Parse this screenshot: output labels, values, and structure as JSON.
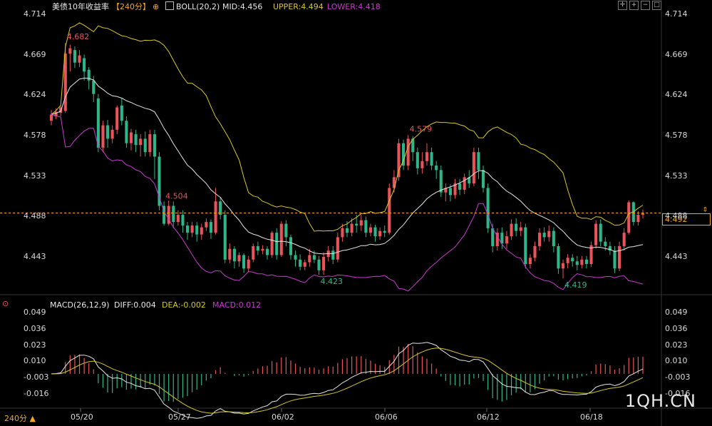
{
  "header": {
    "instrument": "美债10年收益率",
    "period_badge": "【240分】",
    "indicator_name": "BOLL(20,2)",
    "mid": "MID:4.456",
    "upper": "UPPER:4.494",
    "lower": "LOWER:4.418"
  },
  "macd_header": {
    "name": "MACD(26,12,9)",
    "diff": "DIFF:0.004",
    "dea": "DEA:-0.002",
    "macd": "MACD:0.012"
  },
  "price_axis": [
    "4.714",
    "4.669",
    "4.624",
    "4.578",
    "4.533",
    "4.488",
    "4.443"
  ],
  "macd_axis": [
    "0.049",
    "0.036",
    "0.023",
    "0.010",
    "-0.003",
    "-0.016"
  ],
  "date_axis": [
    "05/20",
    "05/27",
    "06/02",
    "06/06",
    "06/12",
    "06/18"
  ],
  "annotations": {
    "high1": "4.682",
    "high2": "4.579",
    "high3": "4.504",
    "low1": "4.423",
    "low2": "4.419"
  },
  "current_price": "4.492",
  "period_selector": "240分",
  "watermark": "1QH.CN",
  "colors": {
    "up": "#e8545a",
    "down": "#2fb58a",
    "mid": "#e6e6e6",
    "upper": "#d8c72b",
    "lower": "#c93ad0",
    "dea": "#d8c72b",
    "price_line": "#f5a623"
  },
  "icons": [
    "settings-gear-icon",
    "crosshair-icon",
    "zoom-in-icon",
    "zoom-out-icon",
    "fullscreen-icon",
    "chart-type-icon"
  ],
  "chart_data": [
    {
      "type": "candlestick",
      "title": "美债10年收益率",
      "period": "240分",
      "ylim": [
        4.4,
        4.72
      ],
      "x_dates": [
        "05/20",
        "05/27",
        "06/02",
        "06/06",
        "06/12",
        "06/18"
      ],
      "candles": [
        [
          4.595,
          4.602,
          4.59,
          4.607
        ],
        [
          4.6,
          4.605,
          4.597,
          4.609
        ],
        [
          4.604,
          4.61,
          4.6,
          4.612
        ],
        [
          4.606,
          4.67,
          4.604,
          4.682
        ],
        [
          4.67,
          4.676,
          4.65,
          4.68
        ],
        [
          4.674,
          4.66,
          4.654,
          4.678
        ],
        [
          4.66,
          4.668,
          4.655,
          4.674
        ],
        [
          4.665,
          4.65,
          4.64,
          4.669
        ],
        [
          4.652,
          4.64,
          4.63,
          4.655
        ],
        [
          4.64,
          4.625,
          4.616,
          4.645
        ],
        [
          4.62,
          4.565,
          4.56,
          4.625
        ],
        [
          4.565,
          4.59,
          4.56,
          4.595
        ],
        [
          4.59,
          4.575,
          4.565,
          4.596
        ],
        [
          4.575,
          4.585,
          4.57,
          4.59
        ],
        [
          4.585,
          4.61,
          4.58,
          4.612
        ],
        [
          4.612,
          4.595,
          4.59,
          4.62
        ],
        [
          4.595,
          4.57,
          4.565,
          4.6
        ],
        [
          4.57,
          4.582,
          4.562,
          4.586
        ],
        [
          4.58,
          4.568,
          4.56,
          4.585
        ],
        [
          4.568,
          4.575,
          4.555,
          4.58
        ],
        [
          4.575,
          4.56,
          4.555,
          4.583
        ],
        [
          4.56,
          4.58,
          4.555,
          4.585
        ],
        [
          4.58,
          4.555,
          4.53,
          4.585
        ],
        [
          4.555,
          4.5,
          4.495,
          4.56
        ],
        [
          4.5,
          4.48,
          4.478,
          4.505
        ],
        [
          4.48,
          4.5,
          4.478,
          4.506
        ],
        [
          4.5,
          4.482,
          4.475,
          4.505
        ],
        [
          4.482,
          4.49,
          4.478,
          4.495
        ],
        [
          4.49,
          4.478,
          4.47,
          4.495
        ],
        [
          4.478,
          4.47,
          4.462,
          4.482
        ],
        [
          4.47,
          4.478,
          4.465,
          4.482
        ],
        [
          4.478,
          4.468,
          4.46,
          4.482
        ],
        [
          4.468,
          4.476,
          4.462,
          4.48
        ],
        [
          4.476,
          4.482,
          4.472,
          4.486
        ],
        [
          4.482,
          4.47,
          4.463,
          4.485
        ],
        [
          4.47,
          4.505,
          4.468,
          4.52
        ],
        [
          4.505,
          4.49,
          4.485,
          4.51
        ],
        [
          4.49,
          4.44,
          4.436,
          4.495
        ],
        [
          4.44,
          4.452,
          4.436,
          4.458
        ],
        [
          4.452,
          4.438,
          4.43,
          4.455
        ],
        [
          4.438,
          4.445,
          4.432,
          4.448
        ],
        [
          4.445,
          4.43,
          4.425,
          4.447
        ],
        [
          4.43,
          4.44,
          4.426,
          4.444
        ],
        [
          4.44,
          4.455,
          4.437,
          4.458
        ],
        [
          4.455,
          4.45,
          4.445,
          4.46
        ],
        [
          4.45,
          4.452,
          4.446,
          4.456
        ],
        [
          4.452,
          4.445,
          4.44,
          4.455
        ],
        [
          4.445,
          4.47,
          4.442,
          4.472
        ],
        [
          4.47,
          4.445,
          4.44,
          4.475
        ],
        [
          4.445,
          4.48,
          4.443,
          4.483
        ],
        [
          4.48,
          4.465,
          4.455,
          4.484
        ],
        [
          4.465,
          4.445,
          4.44,
          4.468
        ],
        [
          4.445,
          4.44,
          4.432,
          4.45
        ],
        [
          4.44,
          4.432,
          4.428,
          4.446
        ],
        [
          4.432,
          4.437,
          4.428,
          4.44
        ],
        [
          4.437,
          4.445,
          4.432,
          4.452
        ],
        [
          4.445,
          4.44,
          4.436,
          4.45
        ],
        [
          4.44,
          4.428,
          4.423,
          4.444
        ],
        [
          4.428,
          4.443,
          4.423,
          4.448
        ],
        [
          4.443,
          4.45,
          4.438,
          4.455
        ],
        [
          4.45,
          4.44,
          4.435,
          4.455
        ],
        [
          4.44,
          4.465,
          4.437,
          4.47
        ],
        [
          4.465,
          4.475,
          4.46,
          4.48
        ],
        [
          4.475,
          4.47,
          4.465,
          4.483
        ],
        [
          4.47,
          4.48,
          4.466,
          4.486
        ],
        [
          4.48,
          4.478,
          4.47,
          4.49
        ],
        [
          4.478,
          4.484,
          4.472,
          4.49
        ],
        [
          4.484,
          4.47,
          4.465,
          4.488
        ],
        [
          4.47,
          4.476,
          4.466,
          4.48
        ],
        [
          4.476,
          4.466,
          4.46,
          4.479
        ],
        [
          4.466,
          4.472,
          4.462,
          4.476
        ],
        [
          4.472,
          4.47,
          4.465,
          4.478
        ],
        [
          4.47,
          4.52,
          4.468,
          4.525
        ],
        [
          4.52,
          4.532,
          4.515,
          4.54
        ],
        [
          4.532,
          4.57,
          4.528,
          4.575
        ],
        [
          4.57,
          4.545,
          4.54,
          4.574
        ],
        [
          4.545,
          4.575,
          4.54,
          4.579
        ],
        [
          4.575,
          4.56,
          4.55,
          4.578
        ],
        [
          4.56,
          4.542,
          4.535,
          4.565
        ],
        [
          4.542,
          4.55,
          4.536,
          4.56
        ],
        [
          4.55,
          4.56,
          4.545,
          4.57
        ],
        [
          4.56,
          4.545,
          4.54,
          4.565
        ],
        [
          4.545,
          4.54,
          4.53,
          4.55
        ],
        [
          4.54,
          4.515,
          4.51,
          4.545
        ],
        [
          4.515,
          4.52,
          4.505,
          4.525
        ],
        [
          4.52,
          4.512,
          4.505,
          4.524
        ],
        [
          4.512,
          4.525,
          4.508,
          4.53
        ],
        [
          4.525,
          4.518,
          4.512,
          4.53
        ],
        [
          4.518,
          4.532,
          4.513,
          4.536
        ],
        [
          4.532,
          4.525,
          4.52,
          4.54
        ],
        [
          4.525,
          4.56,
          4.522,
          4.565
        ],
        [
          4.56,
          4.54,
          4.53,
          4.565
        ],
        [
          4.54,
          4.52,
          4.515,
          4.545
        ],
        [
          4.52,
          4.475,
          4.47,
          4.525
        ],
        [
          4.475,
          4.455,
          4.448,
          4.48
        ],
        [
          4.455,
          4.47,
          4.45,
          4.475
        ],
        [
          4.47,
          4.458,
          4.452,
          4.476
        ],
        [
          4.458,
          4.466,
          4.452,
          4.472
        ],
        [
          4.466,
          4.48,
          4.462,
          4.485
        ],
        [
          4.48,
          4.472,
          4.466,
          4.486
        ],
        [
          4.472,
          4.476,
          4.466,
          4.482
        ],
        [
          4.476,
          4.435,
          4.43,
          4.48
        ],
        [
          4.435,
          4.442,
          4.43,
          4.446
        ],
        [
          4.442,
          4.455,
          4.438,
          4.46
        ],
        [
          4.455,
          4.47,
          4.45,
          4.475
        ],
        [
          4.47,
          4.465,
          4.46,
          4.476
        ],
        [
          4.465,
          4.472,
          4.46,
          4.478
        ],
        [
          4.472,
          4.455,
          4.448,
          4.476
        ],
        [
          4.455,
          4.43,
          4.424,
          4.458
        ],
        [
          4.43,
          4.436,
          4.419,
          4.44
        ],
        [
          4.436,
          4.442,
          4.43,
          4.446
        ],
        [
          4.442,
          4.438,
          4.432,
          4.446
        ],
        [
          4.438,
          4.434,
          4.428,
          4.444
        ],
        [
          4.434,
          4.44,
          4.43,
          4.444
        ],
        [
          4.44,
          4.435,
          4.43,
          4.444
        ],
        [
          4.435,
          4.456,
          4.432,
          4.46
        ],
        [
          4.456,
          4.48,
          4.452,
          4.484
        ],
        [
          4.48,
          4.46,
          4.455,
          4.485
        ],
        [
          4.46,
          4.455,
          4.45,
          4.465
        ],
        [
          4.455,
          4.45,
          4.445,
          4.46
        ],
        [
          4.45,
          4.43,
          4.425,
          4.455
        ],
        [
          4.43,
          4.455,
          4.427,
          4.46
        ],
        [
          4.455,
          4.47,
          4.45,
          4.475
        ],
        [
          4.47,
          4.504,
          4.468,
          4.506
        ],
        [
          4.504,
          4.482,
          4.478,
          4.505
        ],
        [
          4.482,
          4.49,
          4.478,
          4.494
        ],
        [
          4.49,
          4.492,
          4.486,
          4.496
        ]
      ],
      "candle_fields": [
        "open",
        "close",
        "low",
        "high"
      ]
    },
    {
      "type": "line",
      "title": "MACD(26,12,9)",
      "ylim": [
        -0.022,
        0.052
      ],
      "series_names": [
        "DIFF",
        "DEA",
        "MACD"
      ]
    }
  ]
}
